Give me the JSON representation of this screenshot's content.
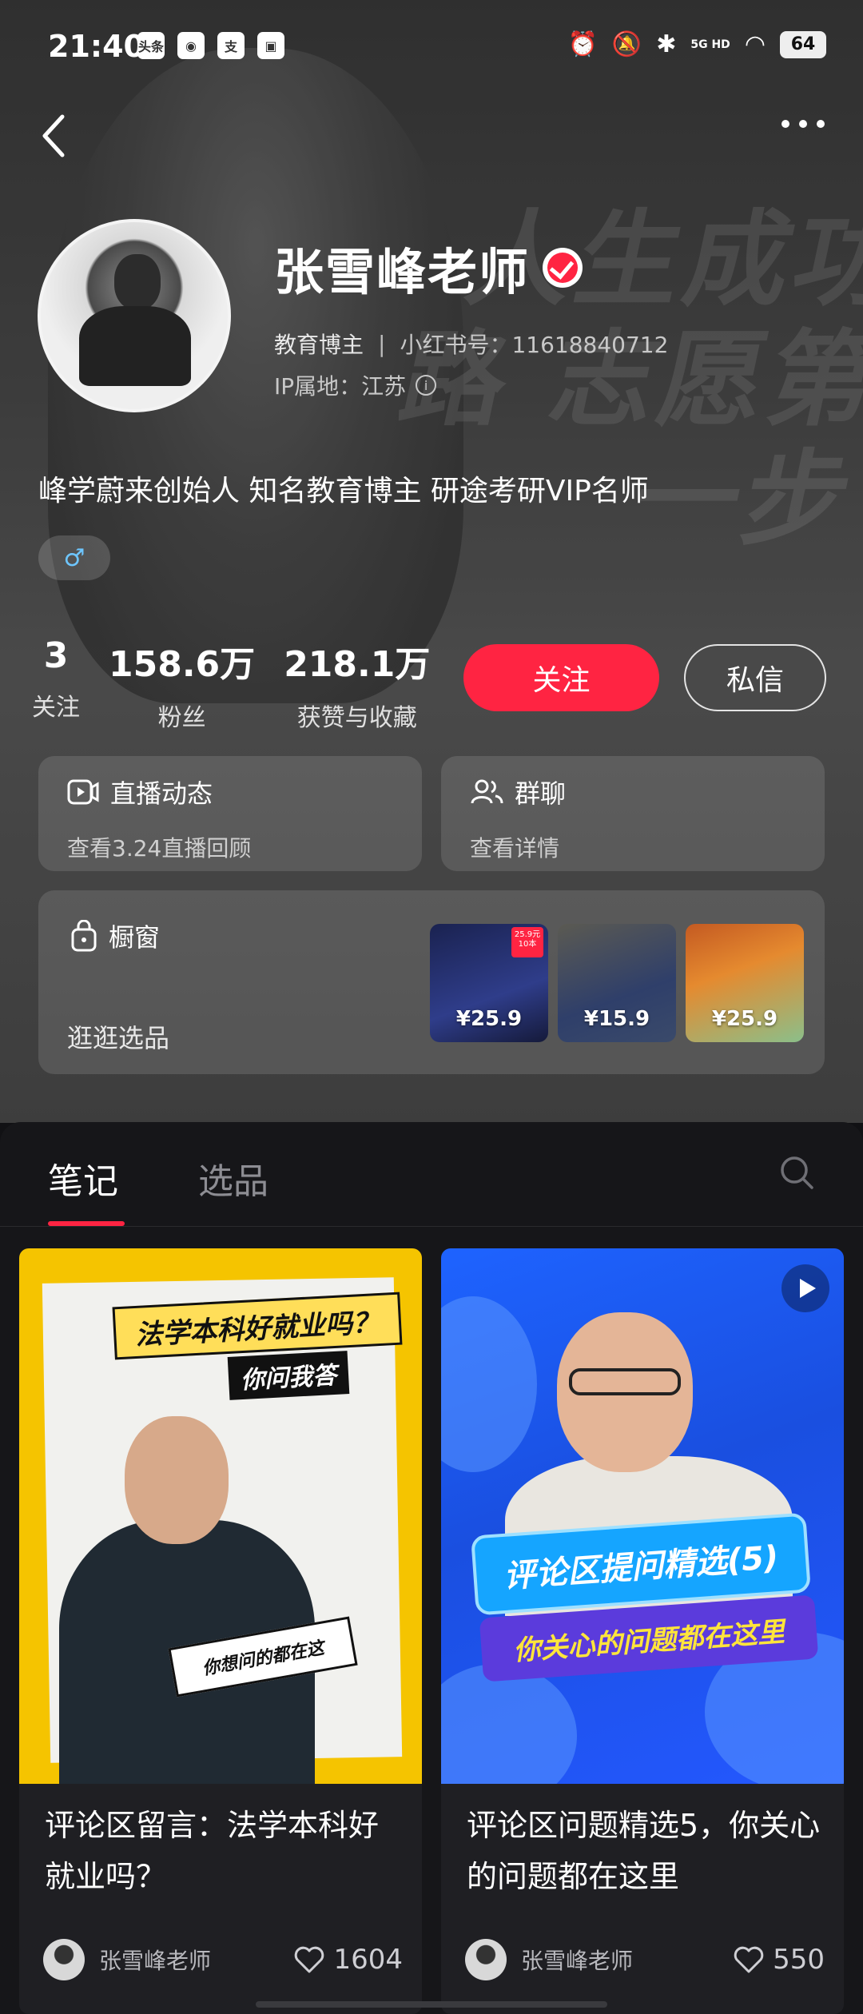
{
  "status_bar": {
    "time": "21:40",
    "app_icons": [
      "toutiao-app-icon",
      "weibo-app-icon",
      "alipay-app-icon",
      "bilibili-app-icon"
    ],
    "toutiao_label": "头条",
    "alipay_label": "支",
    "network": "5G HD",
    "battery": "64"
  },
  "profile": {
    "name": "张雪峰老师",
    "category": "教育博主",
    "id_label": "小红书号：11618840712",
    "ip_label": "IP属地：江苏",
    "bio": "峰学蔚来创始人 知名教育博主 研途考研VIP名师",
    "gender_icon": "♂",
    "background_text": "人生成功路 志愿第一步"
  },
  "stats": [
    {
      "value": "3",
      "label": "关注"
    },
    {
      "value": "158.6万",
      "label": "粉丝"
    },
    {
      "value": "218.1万",
      "label": "获赞与收藏"
    }
  ],
  "actions": {
    "follow": "关注",
    "message": "私信"
  },
  "cards": {
    "live": {
      "title": "直播动态",
      "subtitle": "查看3.24直播回顾"
    },
    "group": {
      "title": "群聊",
      "subtitle": "查看详情"
    },
    "shop": {
      "title": "橱窗",
      "subtitle": "逛逛选品",
      "products": [
        {
          "price": "¥25.9",
          "tag": "25.9元 10本"
        },
        {
          "price": "¥15.9"
        },
        {
          "price": "¥25.9"
        }
      ]
    }
  },
  "tabs": [
    {
      "label": "笔记",
      "active": true
    },
    {
      "label": "选品",
      "active": false
    }
  ],
  "notes": [
    {
      "cover_title_1": "法学本科好就业吗？",
      "cover_title_2": "你问我答",
      "cover_bubble": "你想问的都在这",
      "title": "评论区留言：法学本科好就业吗？",
      "author": "张雪峰老师",
      "likes": "1604"
    },
    {
      "cover_title_1": "评论区提问精选(5)",
      "cover_title_2": "你关心的问题都在这里",
      "title": "评论区问题精选5，你关心的问题都在这里",
      "author": "张雪峰老师",
      "likes": "550"
    }
  ],
  "colors": {
    "accent": "#ff2442",
    "panel": "#161619"
  }
}
